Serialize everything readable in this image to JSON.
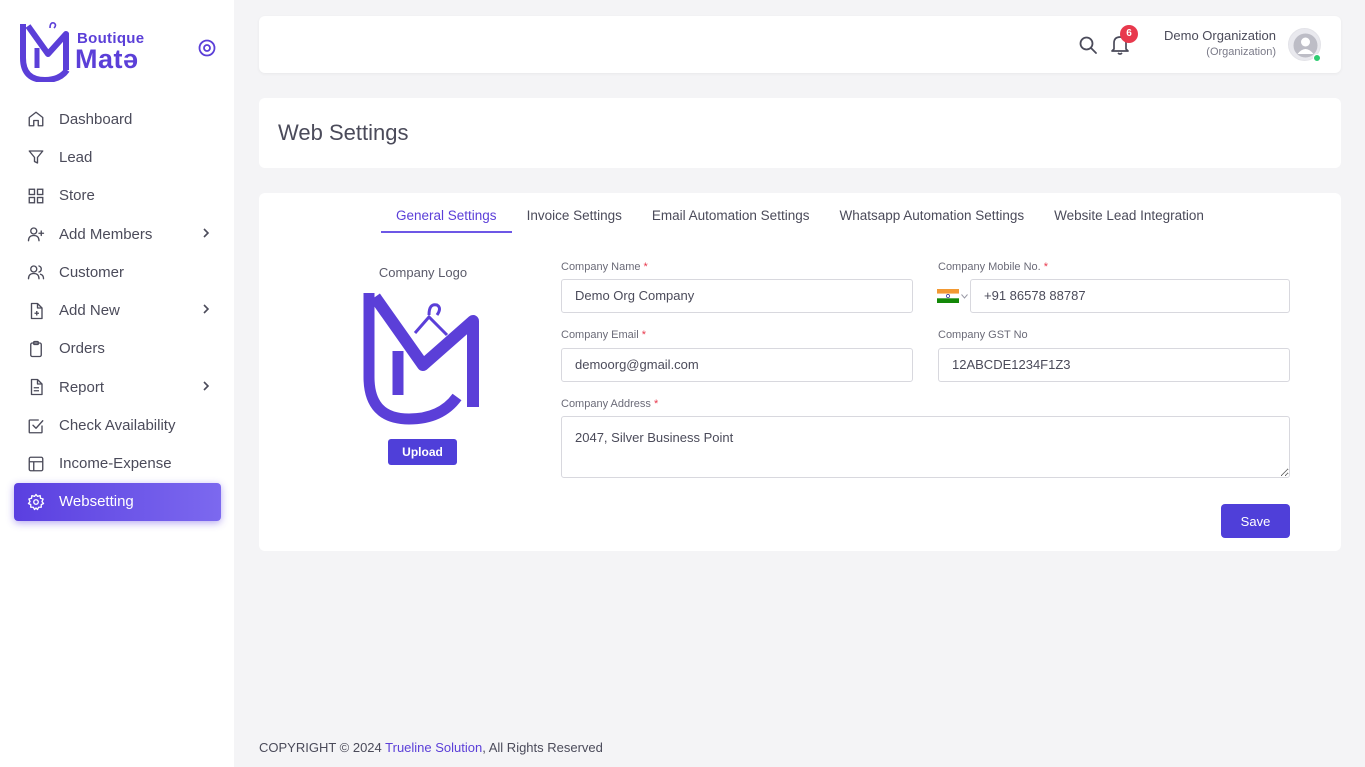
{
  "brand": {
    "line1": "Boutique",
    "line2": "Matə",
    "accent_color": "#5b3fd8"
  },
  "sidebar": {
    "items": [
      {
        "label": "Dashboard",
        "icon": "home-icon",
        "has_submenu": false
      },
      {
        "label": "Lead",
        "icon": "filter-icon",
        "has_submenu": false
      },
      {
        "label": "Store",
        "icon": "grid-icon",
        "has_submenu": false
      },
      {
        "label": "Add Members",
        "icon": "user-plus-icon",
        "has_submenu": true
      },
      {
        "label": "Customer",
        "icon": "users-icon",
        "has_submenu": false
      },
      {
        "label": "Add New",
        "icon": "file-plus-icon",
        "has_submenu": true
      },
      {
        "label": "Orders",
        "icon": "clipboard-icon",
        "has_submenu": false
      },
      {
        "label": "Report",
        "icon": "file-text-icon",
        "has_submenu": true
      },
      {
        "label": "Check Availability",
        "icon": "check-square-icon",
        "has_submenu": false
      },
      {
        "label": "Income-Expense",
        "icon": "layout-icon",
        "has_submenu": false
      },
      {
        "label": "Websetting",
        "icon": "gear-icon",
        "has_submenu": false,
        "active": true
      }
    ]
  },
  "header": {
    "notification_count": "6",
    "org_name": "Demo Organization",
    "org_role": "(Organization)"
  },
  "page": {
    "title": "Web Settings"
  },
  "tabs": [
    {
      "label": "General Settings",
      "active": true
    },
    {
      "label": "Invoice Settings"
    },
    {
      "label": "Email Automation Settings"
    },
    {
      "label": "Whatsapp Automation Settings"
    },
    {
      "label": "Website Lead Integration"
    }
  ],
  "form": {
    "logo_label": "Company Logo",
    "upload_label": "Upload",
    "company_name": {
      "label": "Company Name",
      "value": "Demo Org Company"
    },
    "company_mobile": {
      "label": "Company Mobile No.",
      "value": "+91 86578 88787"
    },
    "company_email": {
      "label": "Company Email",
      "value": "demoorg@gmail.com"
    },
    "company_gst": {
      "label": "Company GST No",
      "value": "12ABCDE1234F1Z3"
    },
    "company_address": {
      "label": "Company Address",
      "value": "2047, Silver Business Point"
    },
    "required_mark": "*",
    "save_label": "Save"
  },
  "footer": {
    "prefix": "COPYRIGHT © 2024 ",
    "link": "Trueline Solution",
    "suffix": ", All Rights Reserved"
  },
  "colors": {
    "primary": "#4f3fd9",
    "badge": "#e8394d",
    "online": "#2ecc71"
  }
}
